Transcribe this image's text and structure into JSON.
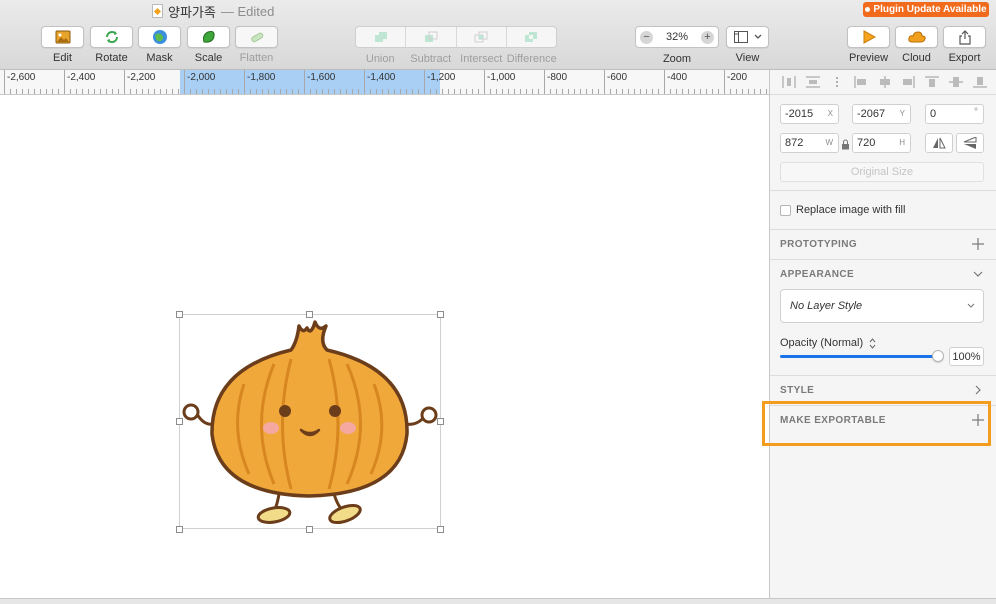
{
  "window": {
    "title": "양파가족",
    "edited": "— Edited",
    "plugin_badge": "Plugin Update Available"
  },
  "toolbar": {
    "edit": "Edit",
    "rotate": "Rotate",
    "mask": "Mask",
    "scale": "Scale",
    "flatten": "Flatten",
    "union": "Union",
    "subtract": "Subtract",
    "intersect": "Intersect",
    "difference": "Difference",
    "zoom_value": "32%",
    "zoom_label": "Zoom",
    "view": "View",
    "preview": "Preview",
    "cloud": "Cloud",
    "export": "Export"
  },
  "ruler": {
    "labels": [
      "-2,600",
      "-2,400",
      "-2,200",
      "-2,000",
      "-1,800",
      "-1,600",
      "-1,400",
      "-1,200",
      "-1,000",
      "-800",
      "-600",
      "-400",
      "-200"
    ]
  },
  "inspector": {
    "x": "-2015",
    "x_label": "X",
    "y": "-2067",
    "y_label": "Y",
    "rotation": "0",
    "rotation_unit": "°",
    "w": "872",
    "w_label": "W",
    "h": "720",
    "h_label": "H",
    "original_size": "Original Size",
    "replace_image": "Replace image with fill",
    "prototyping": "PROTOTYPING",
    "appearance": "APPEARANCE",
    "layer_style": "No Layer Style",
    "opacity_label": "Opacity (Normal)",
    "opacity_value": "100%",
    "opacity_fraction": 1.0,
    "style": "STYLE",
    "make_exportable": "MAKE EXPORTABLE"
  },
  "colors": {
    "highlight": "#f39c1e",
    "badge": "#f26b1d",
    "slider": "#1a73e8",
    "onion_fill": "#f0a83a",
    "onion_outline": "#6b3d1a"
  }
}
